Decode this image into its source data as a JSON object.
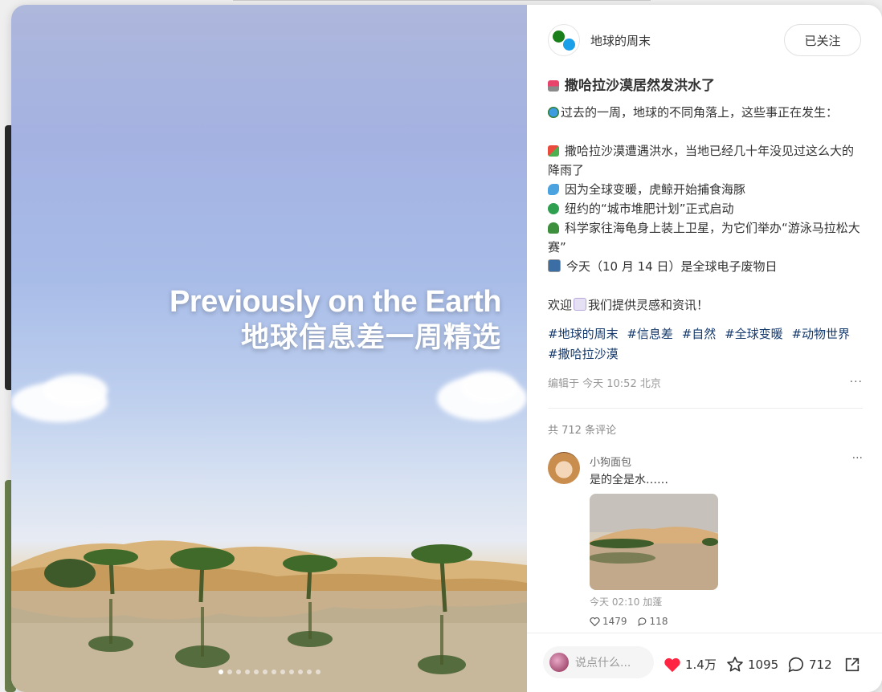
{
  "media": {
    "title_en": "Previously on the Earth",
    "title_zh": "地球信息差一周精选",
    "slide_count": 12,
    "active_slide": 1
  },
  "author": {
    "name": "地球的周末",
    "follow_label": "已关注"
  },
  "post": {
    "title": "撒哈拉沙漠居然发洪水了",
    "lines": [
      "过去的一周，地球的不同角落上，这些事正在发生：",
      "",
      "撒哈拉沙漠遭遇洪水，当地已经几十年没见过这么大的降雨了",
      "因为全球变暖，虎鲸开始捕食海豚",
      "纽约的“城市堆肥计划”正式启动",
      "科学家往海龟身上装上卫星，为它们举办“游泳马拉松大赛”",
      "今天（10 月 14 日）是全球电子废物日",
      "",
      "欢迎",
      "我们提供灵感和资讯！"
    ],
    "tags": [
      "#地球的周末",
      "#信息差",
      "#自然",
      "#全球变暖",
      "#动物世界",
      "#撒哈拉沙漠"
    ],
    "edited": "编辑于 今天 10:52 北京",
    "more": "···"
  },
  "comments": {
    "count_label": "共 712 条评论",
    "items": [
      {
        "user": "小狗面包",
        "text": "是的全是水……",
        "time": "今天 02:10 加蓬",
        "likes": "1479",
        "replies": "118"
      }
    ]
  },
  "footer": {
    "placeholder": "说点什么...",
    "likes": "1.4万",
    "stars": "1095",
    "comments": "712"
  },
  "colors": {
    "like_red": "#ff2442",
    "tag_blue": "#13386c"
  }
}
